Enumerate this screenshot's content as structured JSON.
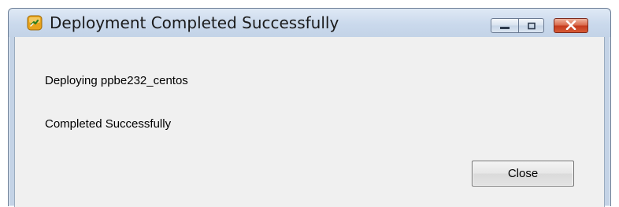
{
  "window": {
    "title": "Deployment Completed Successfully",
    "icon": "vsphere-app-icon",
    "controls": {
      "minimize_icon": "minimize-icon",
      "maximize_icon": "maximize-icon",
      "close_icon": "close-icon"
    }
  },
  "body": {
    "deploying_text": "Deploying ppbe232_centos",
    "status_text": "Completed Successfully"
  },
  "buttons": {
    "close_label": "Close"
  },
  "colors": {
    "titlebar": "#cad9ec",
    "content_background": "#f0f0f0",
    "close_control": "#c4391d",
    "app_icon": "#e8a21c"
  }
}
